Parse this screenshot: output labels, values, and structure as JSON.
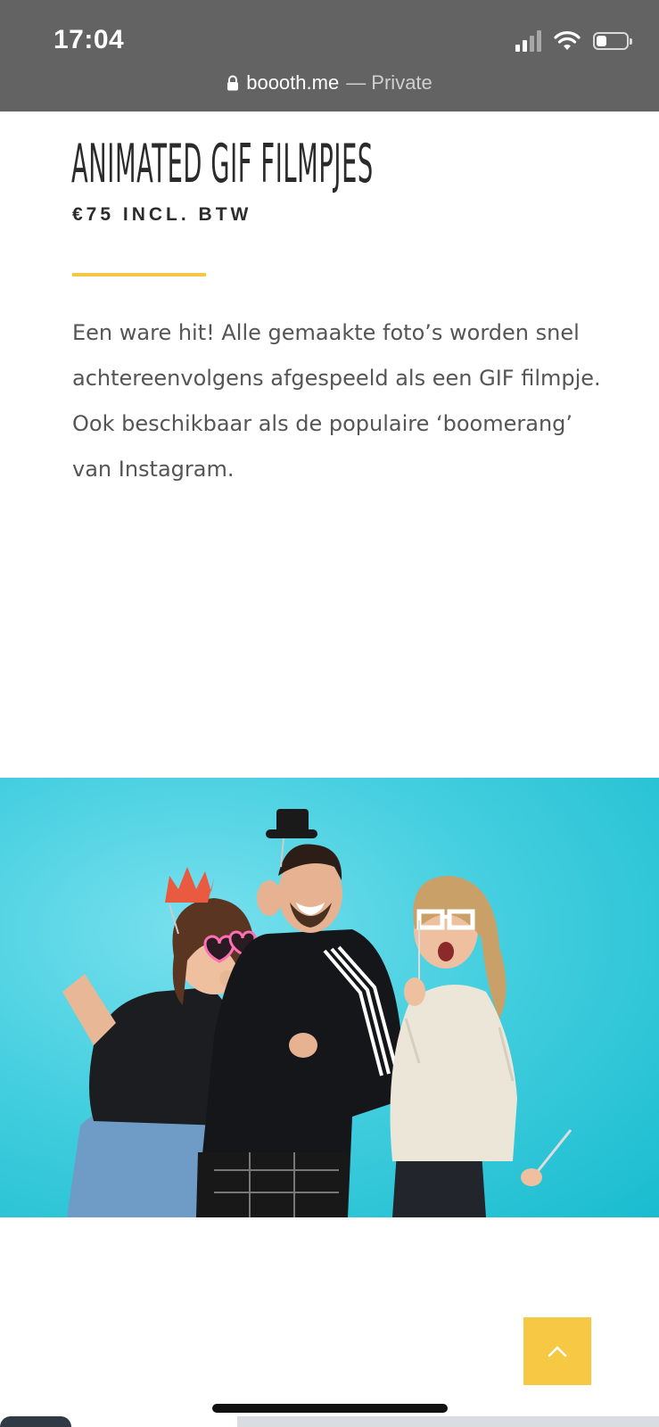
{
  "status_bar": {
    "time": "17:04",
    "signal_icon": "cellular-signal-icon",
    "wifi_icon": "wifi-icon",
    "battery_icon": "battery-icon",
    "battery_level": 0.35
  },
  "browser": {
    "lock_icon": "lock-icon",
    "domain": "boooth.me",
    "mode": "— Private"
  },
  "product": {
    "title": "ANIMATED GIF FILMPJES",
    "price": "€75 INCL. BTW",
    "description": "Een ware hit! Alle gemaakte foto’s worden snel achtereenvolgens afgespeeld als een GIF filmpje. Ook beschikbaar als de populaire ‘boomerang’ van Instagram."
  },
  "colors": {
    "accent": "#f5c842",
    "status_bar_bg": "#636363",
    "photo_bg": "#45cfe0",
    "text": "#2b2b2b",
    "body_text": "#555555"
  },
  "scroll_top": {
    "icon": "chevron-up-icon"
  }
}
